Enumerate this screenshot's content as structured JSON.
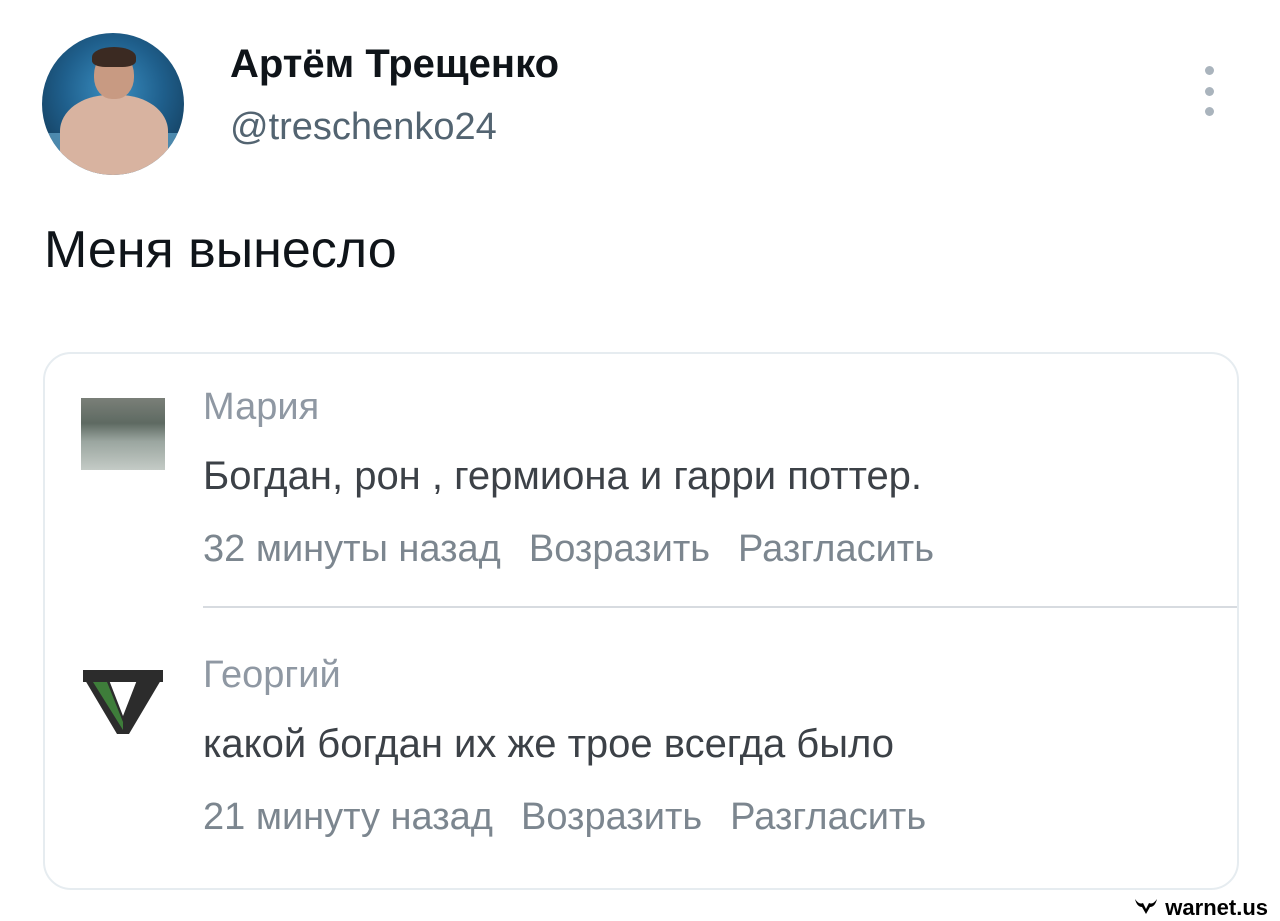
{
  "tweet": {
    "author": {
      "display_name": "Артём Трещенко",
      "handle": "@treschenko24"
    },
    "text": "Меня вынесло"
  },
  "media": {
    "comments": [
      {
        "name": "Мария",
        "text": "Богдан, рон , гермиона и гарри поттер.",
        "time": "32 минуты назад",
        "action_1": "Возразить",
        "action_2": "Разгласить"
      },
      {
        "name": "Георгий",
        "text": "какой богдан их же трое всегда было",
        "time": "21 минуту назад",
        "action_1": "Возразить",
        "action_2": "Разгласить"
      }
    ]
  },
  "watermark": {
    "text": "warnet.us"
  },
  "colors": {
    "text_primary": "#0f1419",
    "text_secondary": "#536471",
    "card_border": "#e6ecf0",
    "v_logo_green": "#3e7d3a"
  },
  "icons": {
    "more": "vertical-ellipsis-icon",
    "watermark": "bull-logo-icon"
  }
}
